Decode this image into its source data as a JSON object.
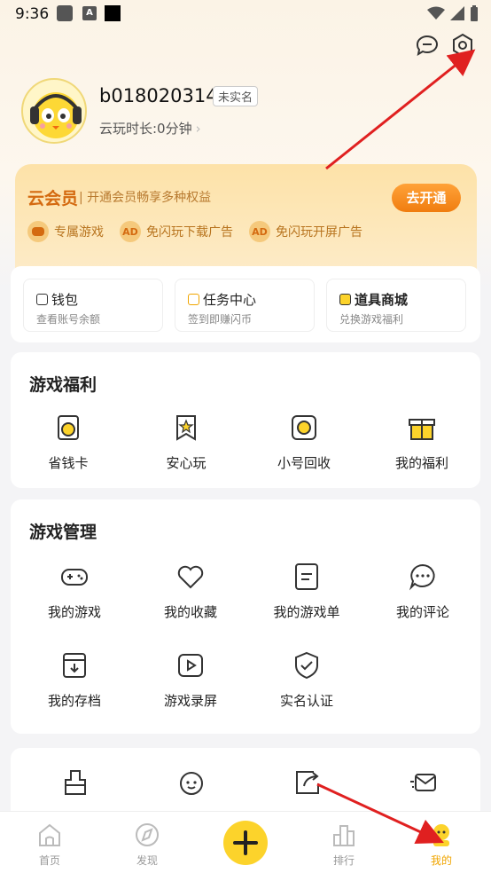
{
  "status_bar": {
    "time": "9:36",
    "notif_icon_letter": "A"
  },
  "header": {
    "chat_icon": "chat-bubble-icon",
    "settings_icon": "hexagon-gear-icon"
  },
  "profile": {
    "username": "b018020314",
    "verify_badge": "未实名",
    "cloud_time": "云玩时长:0分钟",
    "cloud_time_chevron": "›"
  },
  "vip": {
    "title": "云会员",
    "desc": "开通会员畅享多种权益",
    "button": "去开通",
    "perks": [
      {
        "label": "专属游戏",
        "icon": "gamepad-icon"
      },
      {
        "label": "免闪玩下载广告",
        "icon": "no-ad-icon"
      },
      {
        "label": "免闪玩开屏广告",
        "icon": "no-ad-icon"
      }
    ],
    "perk_icon_text": "AD"
  },
  "wallet": [
    {
      "title": "钱包",
      "sub": "查看账号余额"
    },
    {
      "title": "任务中心",
      "sub": "签到即赚闪币"
    },
    {
      "title": "道具商城",
      "sub": "兑换游戏福利"
    }
  ],
  "welfare": {
    "title": "游戏福利",
    "items": [
      {
        "label": "省钱卡",
        "icon": "money-card-icon"
      },
      {
        "label": "安心玩",
        "icon": "star-badge-icon"
      },
      {
        "label": "小号回收",
        "icon": "recycle-icon"
      },
      {
        "label": "我的福利",
        "icon": "gift-icon"
      }
    ]
  },
  "management": {
    "title": "游戏管理",
    "items": [
      {
        "label": "我的游戏",
        "icon": "gamepad-icon"
      },
      {
        "label": "我的收藏",
        "icon": "heart-icon"
      },
      {
        "label": "我的游戏单",
        "icon": "list-doc-icon"
      },
      {
        "label": "我的评论",
        "icon": "comment-icon"
      },
      {
        "label": "我的存档",
        "icon": "archive-icon"
      },
      {
        "label": "游戏录屏",
        "icon": "video-icon"
      },
      {
        "label": "实名认证",
        "icon": "shield-check-icon"
      }
    ]
  },
  "more_tools": [
    "brush-icon",
    "face-icon",
    "share-icon",
    "mail-icon"
  ],
  "bottom_nav": [
    {
      "label": "首页",
      "icon": "home-icon"
    },
    {
      "label": "发现",
      "icon": "compass-icon"
    },
    {
      "label": "",
      "icon": "plus-icon"
    },
    {
      "label": "排行",
      "icon": "rank-icon"
    },
    {
      "label": "我的",
      "icon": "me-icon"
    }
  ],
  "colors": {
    "accent": "#fcd32b",
    "vip_orange": "#f07d10",
    "arrow_red": "#e02020"
  }
}
